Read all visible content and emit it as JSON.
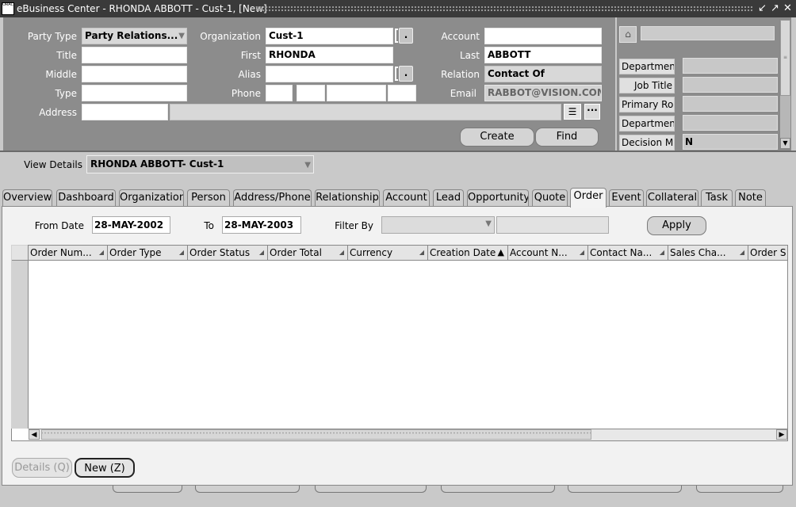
{
  "window": {
    "title": "eBusiness Center - RHONDA ABBOTT - Cust-1, [New]",
    "app_icon_text": "ORACLE"
  },
  "header": {
    "party_type_label": "Party Type",
    "party_type_value": "Party Relations...",
    "organization_label": "Organization",
    "organization_value": "Cust-1",
    "account_label": "Account",
    "account_value": "",
    "title_label": "Title",
    "title_value": "",
    "first_label": "First",
    "first_value": "RHONDA",
    "last_label": "Last",
    "last_value": "ABBOTT",
    "middle_label": "Middle",
    "middle_value": "",
    "alias_label": "Alias",
    "alias_value": "",
    "relation_label": "Relation",
    "relation_value": "Contact Of",
    "type_label": "Type",
    "type_value": "",
    "phone_label": "Phone",
    "email_label": "Email",
    "email_value": "RABBOT@VISION.COM",
    "address_label": "Address",
    "address_value": "",
    "create_button": "Create",
    "find_button": "Find",
    "lov_button": "."
  },
  "right_panel": {
    "rows": [
      {
        "label": "Department",
        "value": ""
      },
      {
        "label": "Job Title",
        "value": ""
      },
      {
        "label": "Primary Rol",
        "value": ""
      },
      {
        "label": "Department",
        "value": ""
      },
      {
        "label": "Decision Ma",
        "value": "N"
      }
    ]
  },
  "view_details": {
    "label": "View Details",
    "value": "RHONDA ABBOTT- Cust-1"
  },
  "tabs": [
    "Overview",
    "Dashboard",
    "Organization",
    "Person",
    "Address/Phone",
    "Relationship",
    "Account",
    "Lead",
    "Opportunity",
    "Quote",
    "Order",
    "Event",
    "Collateral",
    "Task",
    "Note"
  ],
  "active_tab": "Order",
  "filters": {
    "from_date_label": "From Date",
    "from_date_value": "28-MAY-2002",
    "to_label": "To",
    "to_value": "28-MAY-2003",
    "filter_by_label": "Filter By",
    "filter_by_value": "",
    "apply_button": "Apply"
  },
  "table": {
    "columns": [
      "Order Num...",
      "Order Type",
      "Order Status",
      "Order Total",
      "Currency",
      "Creation Date",
      "Account N...",
      "Contact Na...",
      "Sales Cha...",
      "Order S"
    ],
    "sorted_column": "Creation Date",
    "rows": []
  },
  "bottom": {
    "details_button": "Details (Q)",
    "new_button": "New (Z)"
  },
  "colors": {
    "titlebar": "#3a3a3a",
    "header_panel": "#8c8c8c",
    "tab_pane": "#f2f2f2"
  }
}
